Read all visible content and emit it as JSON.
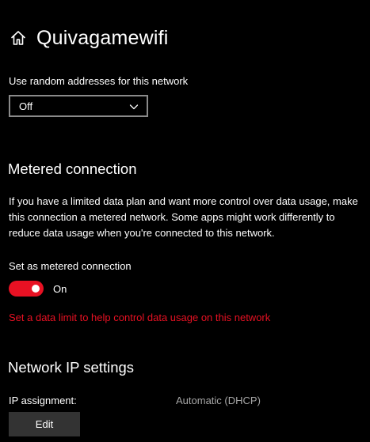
{
  "header": {
    "title": "Quivagamewifi",
    "icon": "home-icon"
  },
  "random_addresses": {
    "label": "Use random addresses for this network",
    "selected": "Off",
    "icon": "chevron-down-icon"
  },
  "metered": {
    "heading": "Metered connection",
    "description": "If you have a limited data plan and want more control over data usage, make this connection a metered network. Some apps might work differently to reduce data usage when you're connected to this network.",
    "toggle_label": "Set as metered connection",
    "toggle_state": "On",
    "toggle_on": true,
    "link": "Set a data limit to help control data usage on this network"
  },
  "ip_settings": {
    "heading": "Network IP settings",
    "assignment_label": "IP assignment:",
    "assignment_value": "Automatic (DHCP)",
    "edit_label": "Edit"
  },
  "colors": {
    "background": "#000000",
    "text": "#ffffff",
    "accent": "#e81123",
    "muted": "#a6a6a6",
    "button": "#333333"
  }
}
